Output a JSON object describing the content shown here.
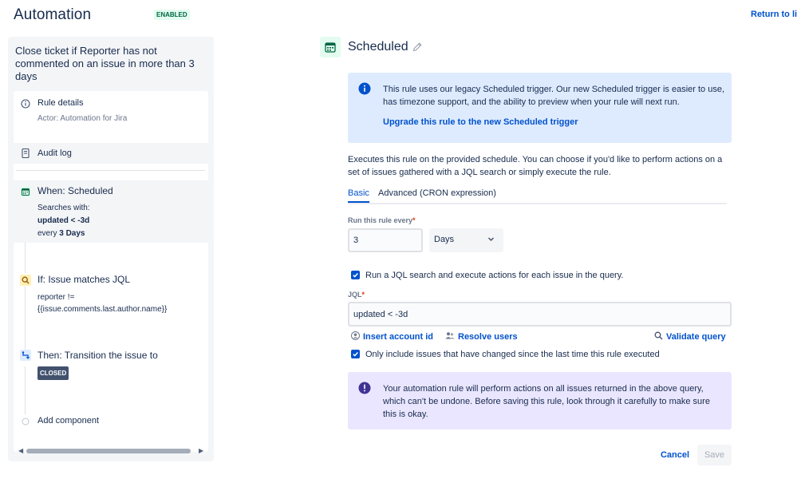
{
  "header": {
    "title": "Automation",
    "status_badge": "ENABLED",
    "return_link": "Return to lis"
  },
  "sidebar": {
    "rule_name": "Close ticket if Reporter has not commented on an issue in more than 3 days",
    "rule_details": {
      "label": "Rule details",
      "sub": "Actor: Automation for Jira",
      "icon": "info-icon"
    },
    "audit_log": {
      "label": "Audit log",
      "icon": "document-icon"
    },
    "components": [
      {
        "title": "When: Scheduled",
        "icon": "calendar-icon",
        "lines": [
          "Searches with:"
        ],
        "jql_bold": "updated < -3d",
        "every_prefix": "every ",
        "every_bold": "3 Days"
      },
      {
        "title": "If: Issue matches JQL",
        "icon": "search-icon",
        "lines": [
          "reporter !=",
          "{{issue.comments.last.author.name}}"
        ]
      },
      {
        "title": "Then: Transition the issue to",
        "icon": "transition-icon",
        "status": "CLOSED"
      }
    ],
    "add_component": "Add component"
  },
  "main": {
    "title": "Scheduled",
    "info": {
      "text": "This rule uses our legacy Scheduled trigger. Our new Scheduled trigger is easier to use, has timezone support, and the ability to preview when your rule will next run.",
      "link": "Upgrade this rule to the new Scheduled trigger"
    },
    "description": "Executes this rule on the provided schedule. You can choose if you'd like to perform actions on a set of issues gathered with a JQL search or simply execute the rule.",
    "tabs": [
      {
        "label": "Basic",
        "active": true
      },
      {
        "label": "Advanced (CRON expression)",
        "active": false
      }
    ],
    "run_every": {
      "label": "Run this rule every",
      "required_mark": "*",
      "value": "3",
      "unit": "Days"
    },
    "run_jql_checkbox": {
      "label": "Run a JQL search and execute actions for each issue in the query.",
      "checked": true
    },
    "jql": {
      "label": "JQL",
      "required_mark": "*",
      "value": "updated < -3d"
    },
    "jql_actions": {
      "insert_account": "Insert account id",
      "resolve_users": "Resolve users",
      "validate": "Validate query"
    },
    "only_changed_checkbox": {
      "label": "Only include issues that have changed since the last time this rule executed",
      "checked": true
    },
    "warning": {
      "text": "Your automation rule will perform actions on all issues returned in the above query, which can't be undone. Before saving this rule, look through it carefully to make sure this is okay."
    },
    "buttons": {
      "cancel": "Cancel",
      "save": "Save"
    }
  },
  "colors": {
    "link": "#0052cc",
    "info_bg": "#deebff",
    "warning_bg": "#eae6ff",
    "enabled_bg": "#e3fcef",
    "enabled_fg": "#006644"
  }
}
